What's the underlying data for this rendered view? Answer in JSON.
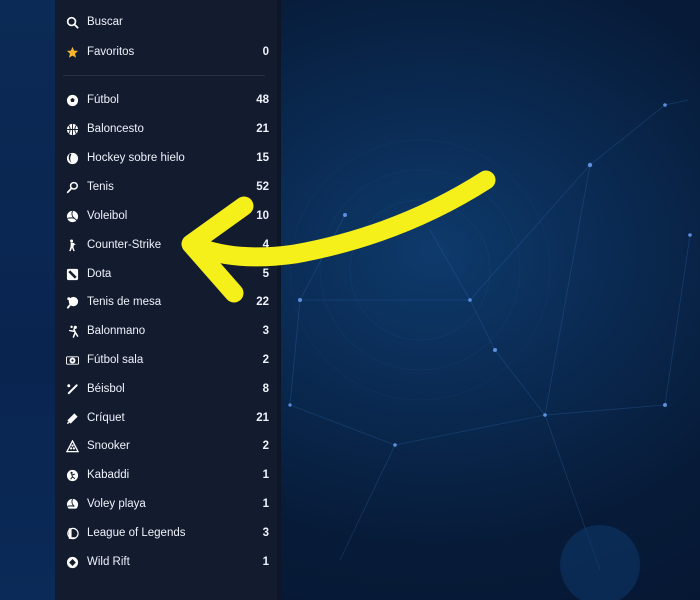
{
  "colors": {
    "sidebar_bg": "#131b2e",
    "background": "#0a2a52",
    "arrow": "#f5ef1a",
    "star": "#f4b52a"
  },
  "search": {
    "label": "Buscar",
    "icon": "search-icon"
  },
  "favorites": {
    "label": "Favoritos",
    "count": "0",
    "icon": "star-icon"
  },
  "sports": [
    {
      "label": "Fútbol",
      "count": "48",
      "icon": "soccer-ball-icon"
    },
    {
      "label": "Baloncesto",
      "count": "21",
      "icon": "basketball-icon"
    },
    {
      "label": "Hockey sobre hielo",
      "count": "15",
      "icon": "hockey-puck-icon"
    },
    {
      "label": "Tenis",
      "count": "52",
      "icon": "tennis-racket-icon"
    },
    {
      "label": "Voleibol",
      "count": "10",
      "icon": "volleyball-icon"
    },
    {
      "label": "Counter-Strike",
      "count": "4",
      "icon": "counter-strike-icon"
    },
    {
      "label": "Dota",
      "count": "5",
      "icon": "dota-icon"
    },
    {
      "label": "Tenis de mesa",
      "count": "22",
      "icon": "ping-pong-icon"
    },
    {
      "label": "Balonmano",
      "count": "3",
      "icon": "handball-icon"
    },
    {
      "label": "Fútbol sala",
      "count": "2",
      "icon": "futsal-icon"
    },
    {
      "label": "Béisbol",
      "count": "8",
      "icon": "baseball-bat-icon"
    },
    {
      "label": "Críquet",
      "count": "21",
      "icon": "cricket-bat-icon"
    },
    {
      "label": "Snooker",
      "count": "2",
      "icon": "snooker-icon"
    },
    {
      "label": "Kabaddi",
      "count": "1",
      "icon": "kabaddi-icon"
    },
    {
      "label": "Voley playa",
      "count": "1",
      "icon": "beach-volleyball-icon"
    },
    {
      "label": "League of Legends",
      "count": "3",
      "icon": "league-of-legends-icon"
    },
    {
      "label": "Wild Rift",
      "count": "1",
      "icon": "wild-rift-icon"
    }
  ]
}
